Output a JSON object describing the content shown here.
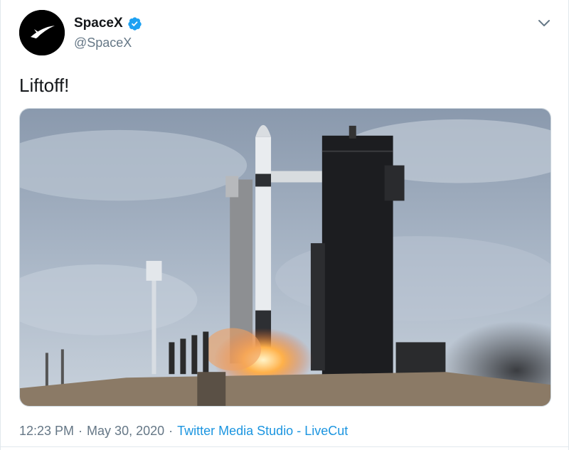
{
  "tweet": {
    "author": {
      "display_name": "SpaceX",
      "handle": "@SpaceX",
      "verified": true,
      "avatar_icon": "spacex-logo-icon"
    },
    "text": "Liftoff!",
    "media": {
      "type": "image",
      "description_icon": "rocket-launch-image"
    },
    "meta": {
      "time": "12:23 PM",
      "separator": "·",
      "date": "May 30, 2020",
      "source": "Twitter Media Studio - LiveCut"
    },
    "menu_icon": "chevron-down-icon"
  },
  "colors": {
    "link": "#1b95e0",
    "verified": "#1da1f2",
    "secondary_text": "#657786",
    "primary_text": "#14171a",
    "border": "#e1e8ed"
  }
}
